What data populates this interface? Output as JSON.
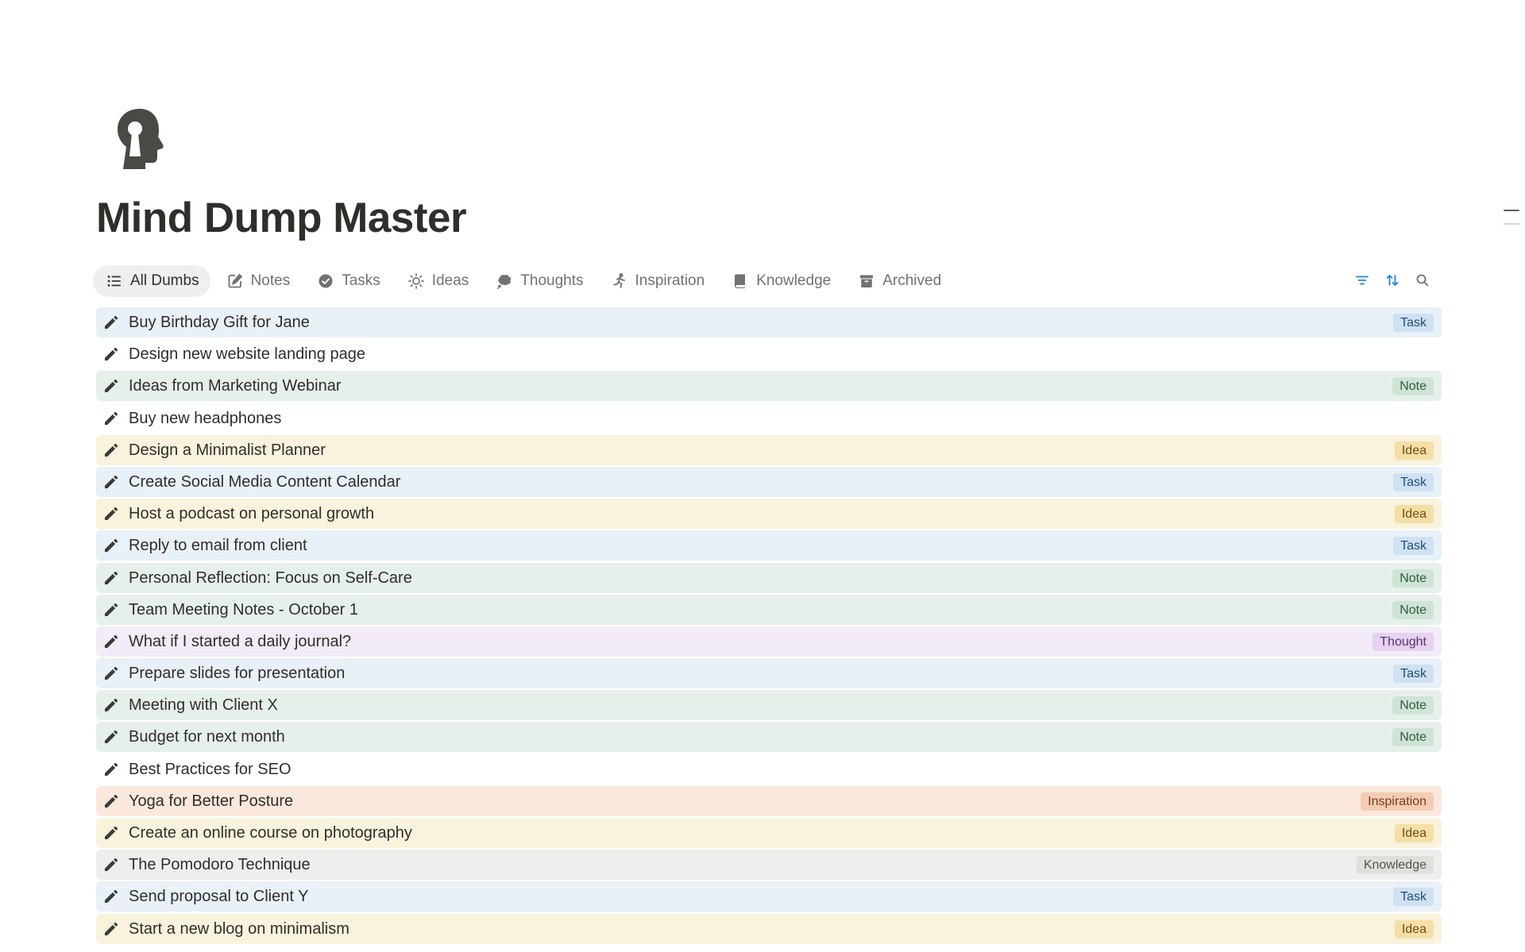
{
  "page": {
    "title": "Mind Dump Master",
    "icon": "head-keyhole-icon"
  },
  "tabs": [
    {
      "label": "All Dumbs",
      "icon": "list-icon",
      "active": true
    },
    {
      "label": "Notes",
      "icon": "edit-note-icon"
    },
    {
      "label": "Tasks",
      "icon": "check-circle-icon"
    },
    {
      "label": "Ideas",
      "icon": "sun-icon"
    },
    {
      "label": "Thoughts",
      "icon": "thought-bubble-icon"
    },
    {
      "label": "Inspiration",
      "icon": "running-person-icon"
    },
    {
      "label": "Knowledge",
      "icon": "book-icon"
    },
    {
      "label": "Archived",
      "icon": "archive-icon"
    }
  ],
  "toolbar": {
    "filter_icon": "filter-icon",
    "sort_icon": "sort-icon",
    "search_icon": "search-icon",
    "accent": "#2383e2"
  },
  "types": {
    "Task": {
      "row_bg": "#e8f0f8",
      "badge_bg": "#cfe1f2",
      "badge_fg": "#1f4f7a"
    },
    "Note": {
      "row_bg": "#e6f0ea",
      "badge_bg": "#cfe4d6",
      "badge_fg": "#2e5b3f"
    },
    "Idea": {
      "row_bg": "#f9f2dc",
      "badge_bg": "#f5dfa6",
      "badge_fg": "#6e4f12"
    },
    "Thought": {
      "row_bg": "#f3ebf7",
      "badge_bg": "#e5d3ef",
      "badge_fg": "#5c2e75"
    },
    "Inspiration": {
      "row_bg": "#fbe8dd",
      "badge_bg": "#f4ccb4",
      "badge_fg": "#7a3b18"
    },
    "Knowledge": {
      "row_bg": "#efeeec",
      "badge_bg": "#e0dfdc",
      "badge_fg": "#55534e"
    },
    "": {
      "row_bg": "#ffffff"
    }
  },
  "items": [
    {
      "title": "Buy Birthday Gift for Jane",
      "type": "Task"
    },
    {
      "title": "Design new website landing page",
      "type": ""
    },
    {
      "title": "Ideas from Marketing Webinar",
      "type": "Note"
    },
    {
      "title": "Buy new headphones",
      "type": ""
    },
    {
      "title": "Design a Minimalist Planner",
      "type": "Idea"
    },
    {
      "title": "Create Social Media Content Calendar",
      "type": "Task"
    },
    {
      "title": "Host a podcast on personal growth",
      "type": "Idea"
    },
    {
      "title": "Reply to email from client",
      "type": "Task"
    },
    {
      "title": "Personal Reflection: Focus on Self-Care",
      "type": "Note"
    },
    {
      "title": "Team Meeting Notes - October 1",
      "type": "Note"
    },
    {
      "title": "What if I started a daily journal?",
      "type": "Thought"
    },
    {
      "title": "Prepare slides for presentation",
      "type": "Task"
    },
    {
      "title": "Meeting with Client X",
      "type": "Note"
    },
    {
      "title": "Budget for next month",
      "type": "Note"
    },
    {
      "title": "Best Practices for SEO",
      "type": ""
    },
    {
      "title": "Yoga for Better Posture",
      "type": "Inspiration"
    },
    {
      "title": "Create an online course on photography",
      "type": "Idea"
    },
    {
      "title": "The Pomodoro Technique",
      "type": "Knowledge"
    },
    {
      "title": "Send proposal to Client Y",
      "type": "Task"
    },
    {
      "title": "Start a new blog on minimalism",
      "type": "Idea"
    }
  ]
}
